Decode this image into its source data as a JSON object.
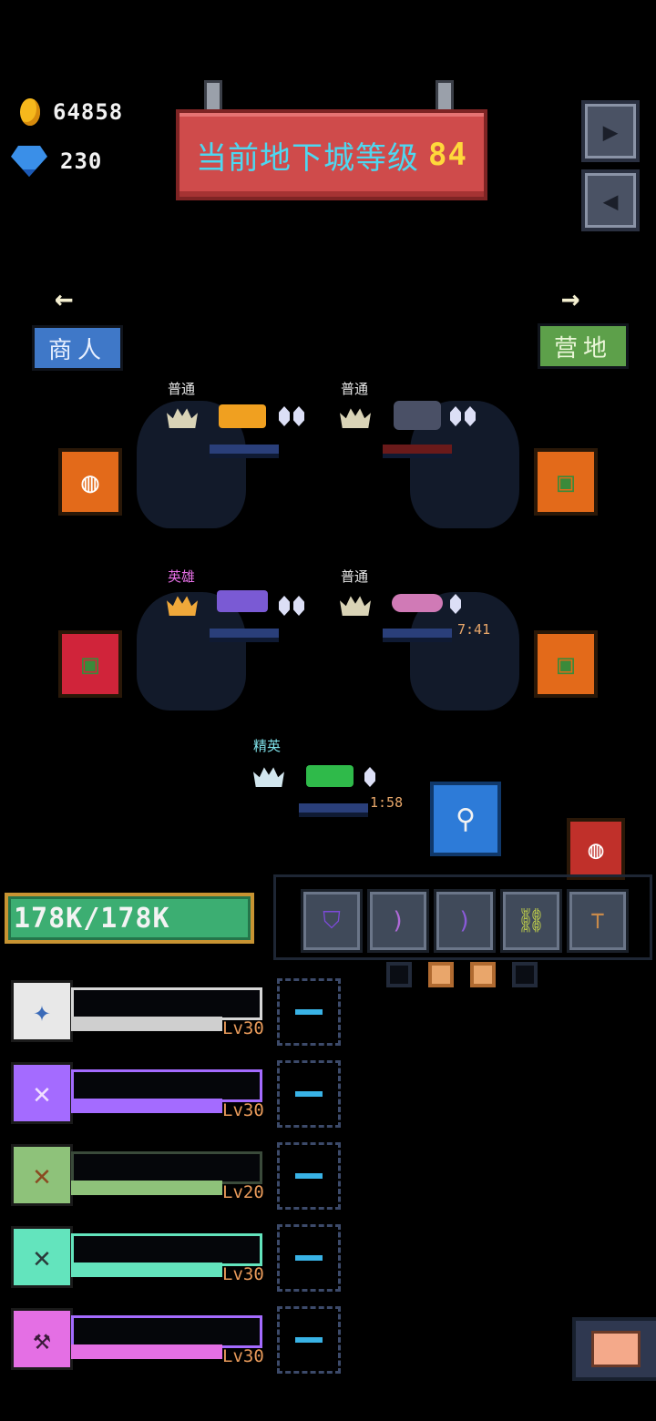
{
  "currency": {
    "gold": "64858",
    "diamonds": "230"
  },
  "banner": {
    "text": "当前地下城等级",
    "level": "84"
  },
  "nav": {
    "left_label": "商人",
    "right_label": "营地",
    "left_arrow": "←",
    "right_arrow": "→"
  },
  "top_buttons": [
    {
      "icon": "exit-icon"
    },
    {
      "icon": "sound-icon"
    }
  ],
  "altars": [
    {
      "rarity": "普通",
      "timer": ""
    },
    {
      "rarity": "普通",
      "timer": ""
    },
    {
      "rarity": "英雄",
      "timer": ""
    },
    {
      "rarity": "普通",
      "timer": "7:41"
    },
    {
      "rarity": "精英",
      "timer": "1:58"
    }
  ],
  "hp": {
    "text": "178K/178K"
  },
  "equipment_slots": [
    "shield-icon",
    "bow-icon",
    "bow-icon",
    "chain-icon",
    "signpost-icon"
  ],
  "page_dots": [
    false,
    true,
    true,
    false
  ],
  "heroes": [
    {
      "level": "Lv30",
      "color": "#bfbfbf",
      "bar_color": "#cfcfcf",
      "fill": 0.78
    },
    {
      "level": "Lv30",
      "color": "#a46bff",
      "bar_color": "#a46bff",
      "fill": 0.78
    },
    {
      "level": "Lv20",
      "color": "#8ec27a",
      "bar_color": "#8ec27a",
      "fill": 0.78
    },
    {
      "level": "Lv30",
      "color": "#63e4bd",
      "bar_color": "#63e4bd",
      "fill": 0.78
    },
    {
      "level": "Lv30",
      "color": "#e46fe4",
      "bar_color": "#e46fe4",
      "fill": 0.78
    }
  ]
}
